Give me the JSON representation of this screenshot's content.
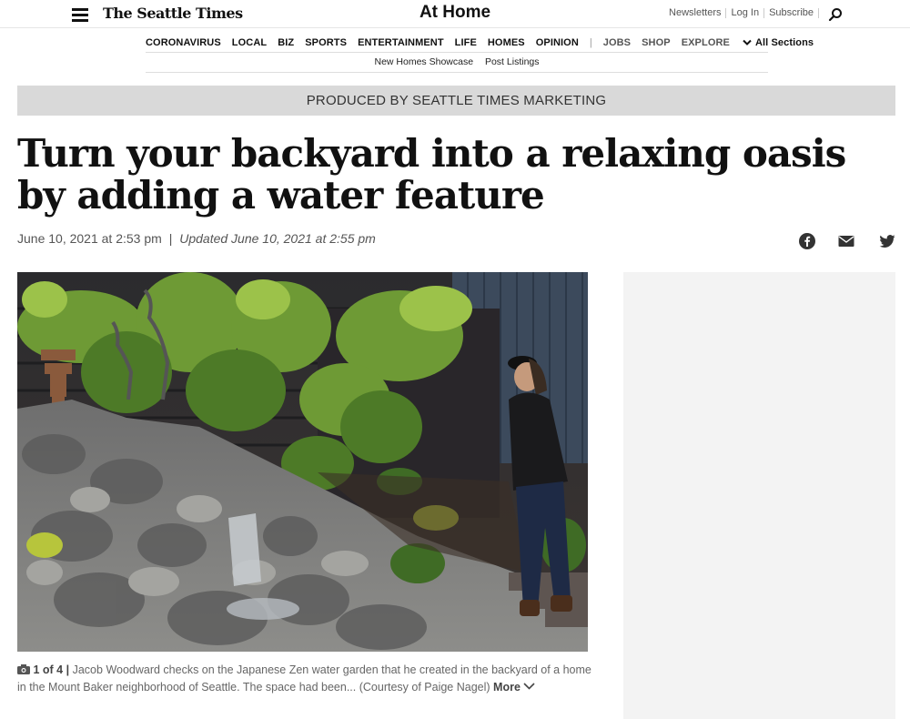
{
  "header": {
    "logo_text": "The Seattle Times",
    "section_title": "At Home",
    "util_links": [
      "Newsletters",
      "Log In",
      "Subscribe"
    ]
  },
  "nav": {
    "items": [
      "CORONAVIRUS",
      "LOCAL",
      "BIZ",
      "SPORTS",
      "ENTERTAINMENT",
      "LIFE",
      "HOMES",
      "OPINION"
    ],
    "separator": "|",
    "secondary": [
      "JOBS",
      "SHOP",
      "EXPLORE"
    ],
    "all_sections": "All Sections"
  },
  "subnav": {
    "items": [
      "New Homes Showcase",
      "Post Listings"
    ]
  },
  "banner": {
    "text": "PRODUCED BY SEATTLE TIMES MARKETING"
  },
  "article": {
    "headline": "Turn your backyard into a relaxing oasis by adding a water feature",
    "published": "June 10, 2021 at 2:53 pm",
    "pipe": "|",
    "updated": "Updated June 10, 2021 at 2:55 pm"
  },
  "photo": {
    "count": "1 of 4",
    "pipe": "|",
    "caption": "Jacob Woodward checks on the Japanese Zen water garden that he created in the backyard of a home in the Mount Baker neighborhood of Seattle. The space had been... (Courtesy of Paige Nagel)",
    "more_label": "More"
  },
  "share_icons": [
    "facebook-icon",
    "email-icon",
    "twitter-icon"
  ],
  "colors": {
    "banner_bg": "#d9d9d9",
    "ad_bg": "#f3f3f3"
  }
}
